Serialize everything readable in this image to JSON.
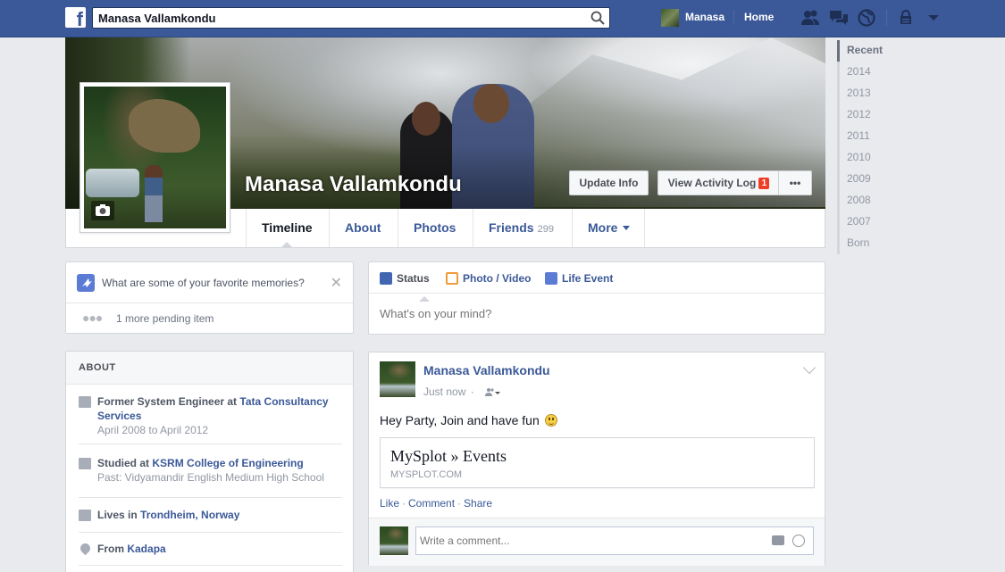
{
  "search": {
    "value": "Manasa Vallamkondu"
  },
  "topnav": {
    "user_name": "Manasa",
    "home_label": "Home"
  },
  "profile": {
    "name": "Manasa Vallamkondu"
  },
  "cover_buttons": {
    "update_info": "Update Info",
    "activity_log": "View Activity Log",
    "activity_badge": "1",
    "more": "•••"
  },
  "tabs": [
    {
      "label": "Timeline"
    },
    {
      "label": "About"
    },
    {
      "label": "Photos"
    },
    {
      "label": "Friends",
      "count": "299"
    },
    {
      "label": "More"
    }
  ],
  "timeline_years": [
    "Recent",
    "2014",
    "2013",
    "2012",
    "2011",
    "2010",
    "2009",
    "2008",
    "2007",
    "Born"
  ],
  "memories": {
    "prompt": "What are some of your favorite memories?",
    "pending": "1 more pending item"
  },
  "about": {
    "heading": "ABOUT",
    "work": {
      "prefix": "Former System Engineer at",
      "employer": "Tata Consultancy Services",
      "dates": "April 2008 to April 2012"
    },
    "education": {
      "prefix": "Studied at",
      "school": "KSRM College of Engineering",
      "past": "Past: Vidyamandir English Medium High School"
    },
    "lives": {
      "prefix": "Lives in",
      "place": "Trondheim, Norway"
    },
    "from": {
      "prefix": "From",
      "place": "Kadapa"
    }
  },
  "composer": {
    "tab_status": "Status",
    "tab_photo": "Photo / Video",
    "tab_event": "Life Event",
    "placeholder": "What's on your mind?"
  },
  "post": {
    "author": "Manasa Vallamkondu",
    "time": "Just now",
    "text": "Hey Party, Join and have fun",
    "link_title": "MySplot » Events",
    "link_domain": "MYSPLOT.COM",
    "actions": {
      "like": "Like",
      "comment": "Comment",
      "share": "Share"
    },
    "comment_placeholder": "Write a comment..."
  },
  "colors": {
    "brand": "#3b5998",
    "badge": "#f03d25",
    "background": "#e9eaed"
  }
}
